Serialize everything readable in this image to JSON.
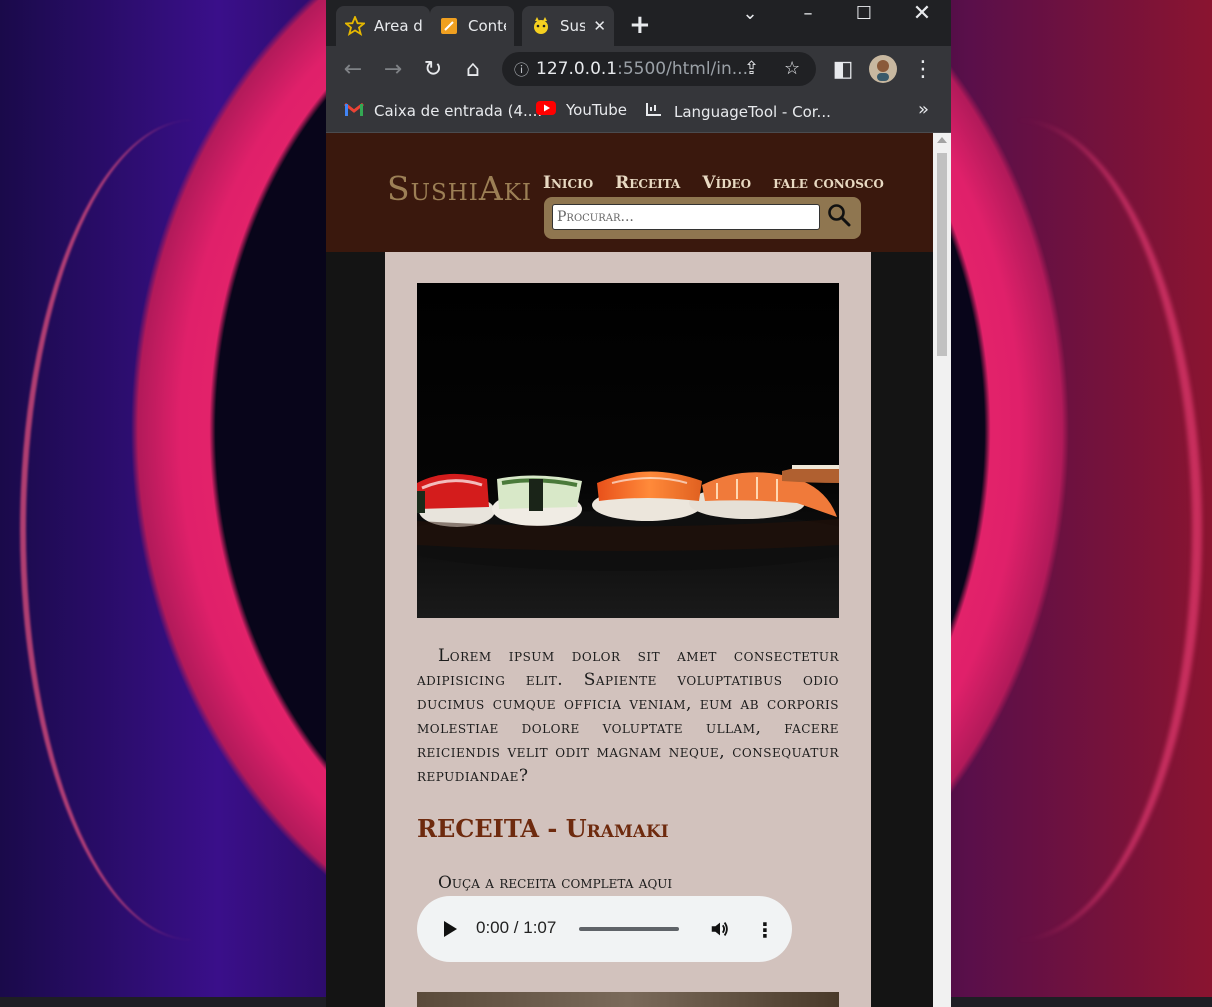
{
  "tabs": [
    {
      "title": "Area de trabalho",
      "icon": "star-icon",
      "active": false
    },
    {
      "title": "Conteúdo",
      "icon": "notepad-icon",
      "active": false
    },
    {
      "title": "SushiAki",
      "icon": "pikachu-icon",
      "active": true
    }
  ],
  "toolbar": {
    "url_host": "127.0.0.1",
    "url_path": ":5500/html/in..."
  },
  "bookmarks": [
    {
      "label": "Caixa de entrada (4....",
      "icon": "gmail-icon"
    },
    {
      "label": "YouTube",
      "icon": "youtube-icon"
    },
    {
      "label": "LanguageTool - Cor...",
      "icon": "languagetool-icon"
    }
  ],
  "site": {
    "logo": "SushiAki",
    "nav": [
      "Inicio",
      "Receita",
      "Vídeo",
      "fale conosco"
    ],
    "search_placeholder": "Procurar...",
    "paragraph": "Lorem ipsum dolor sit amet consectetur adipisicing elit. Sapiente voluptatibus odio ducimus cumque officia veniam, eum ab corporis molestiae dolore voluptate ullam, facere reiciendis velit odit magnam neque, consequatur repudiandae?",
    "recipe_title": "RECEITA - Uramaki",
    "audio_label": "Ouça a receita completa aqui",
    "audio_time": "0:00 / 1:07"
  },
  "colors": {
    "header_bg": "#3a180d",
    "logo": "#9c7f55",
    "content_bg": "#d2c2bd",
    "recipe_title": "#6e2a0e",
    "search_bg": "#8f7650"
  }
}
